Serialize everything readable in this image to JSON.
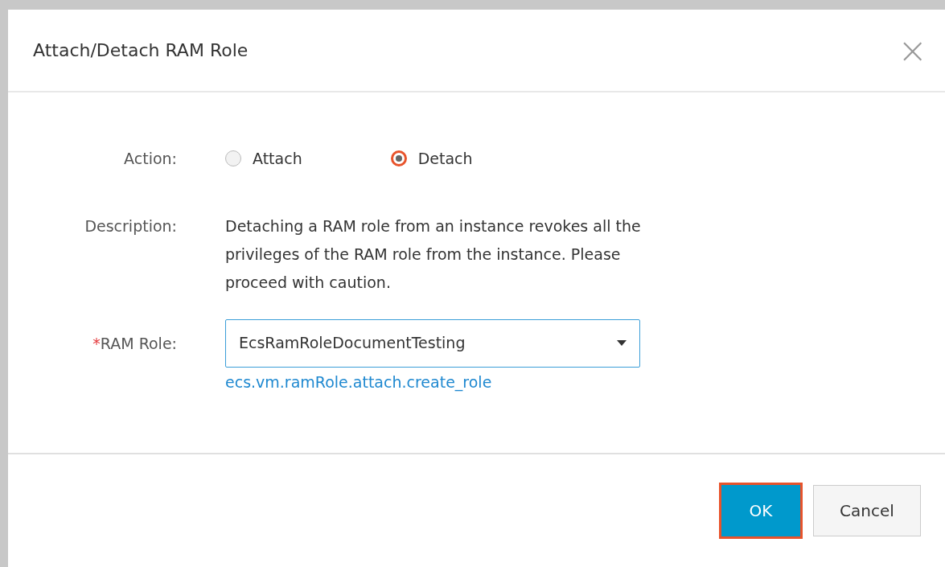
{
  "dialog": {
    "title": "Attach/Detach RAM Role",
    "close": "×"
  },
  "action": {
    "label": "Action:",
    "options": [
      {
        "label": "Attach",
        "selected": false
      },
      {
        "label": "Detach",
        "selected": true
      }
    ]
  },
  "description": {
    "label": "Description:",
    "text": "Detaching a RAM role from an instance revokes all the privileges of the RAM role from the instance. Please proceed with caution."
  },
  "ram_role": {
    "required_mark": "*",
    "label": "RAM Role:",
    "value": "EcsRamRoleDocumentTesting",
    "link": "ecs.vm.ramRole.attach.create_role"
  },
  "buttons": [
    {
      "label": "OK",
      "kind": "primary",
      "highlighted": true
    },
    {
      "label": "Cancel",
      "kind": "default",
      "highlighted": false
    }
  ]
}
